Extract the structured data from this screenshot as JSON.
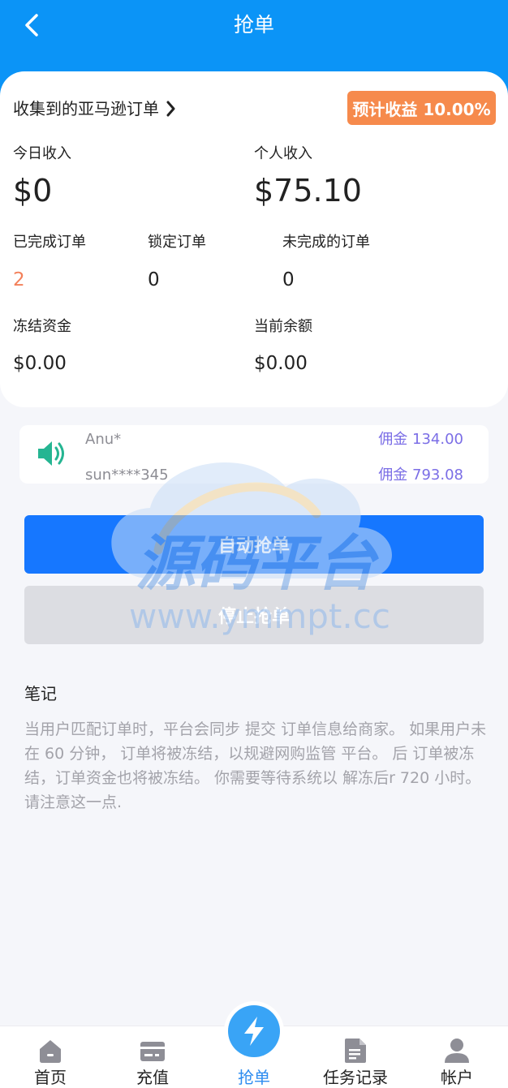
{
  "header": {
    "title": "抢单",
    "back_icon": "chevron-left-icon"
  },
  "summary": {
    "collect_label": "收集到的亚马逊订单",
    "badge": "预计收益 10.00%",
    "today_income_label": "今日收入",
    "today_income_value": "$0",
    "personal_income_label": "个人收入",
    "personal_income_value": "$75.10",
    "completed_label": "已完成订单",
    "completed_value": "2",
    "locked_label": "锁定订单",
    "locked_value": "0",
    "unfinished_label": "未完成的订单",
    "unfinished_value": "0",
    "frozen_label": "冻结资金",
    "frozen_value": "$0.00",
    "balance_label": "当前余额",
    "balance_value": "$0.00"
  },
  "ticker": {
    "icon": "speaker-icon",
    "items": [
      {
        "name": "Anu*",
        "amount": "佣金 134.00"
      },
      {
        "name": "sun****345",
        "amount": "佣金 793.08"
      }
    ]
  },
  "actions": {
    "auto_label": "自动抢单",
    "stop_label": "停止抢单"
  },
  "watermark": {
    "title": "源码平台",
    "url": "www.ymmpt.cc"
  },
  "notes": {
    "title": "笔记",
    "text": "当用户匹配订单时，平台会同步 提交 订单信息给商家。 如果用户未在 60  分钟， 订单将被冻结，以规避网购监管 平台。 后 订单被冻结，订单资金也将被冻结。 你需要等待系统以 解冻后r 720 小时。 请注意这一点."
  },
  "tabbar": {
    "items": [
      {
        "label": "首页",
        "icon": "home-icon"
      },
      {
        "label": "充值",
        "icon": "wallet-icon"
      },
      {
        "label": "抢单",
        "icon": "lightning-icon"
      },
      {
        "label": "任务记录",
        "icon": "document-icon"
      },
      {
        "label": "帐户",
        "icon": "user-icon"
      }
    ],
    "active_color": "#2d8cf0"
  },
  "colors": {
    "header": "#0b94f7",
    "primary_button": "#1677ff",
    "badge": "#f68a4c",
    "commission": "#7b6ee6",
    "speaker": "#25b592"
  }
}
